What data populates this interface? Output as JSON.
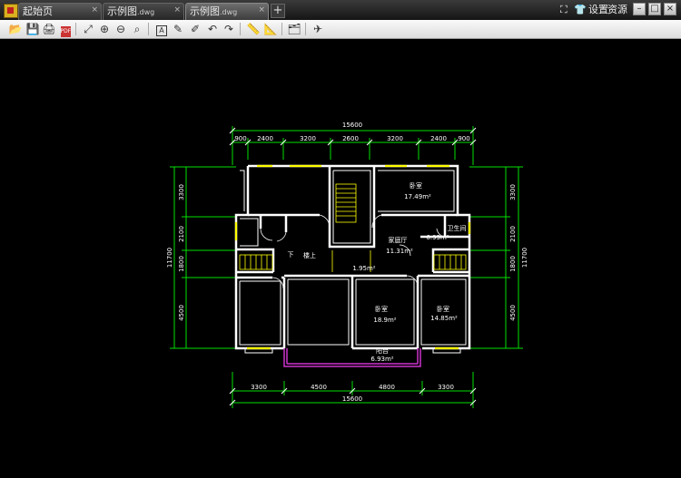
{
  "tabs": [
    {
      "title": "起始页",
      "ext": ""
    },
    {
      "title": "示例图",
      "ext": ".dwg"
    },
    {
      "title": "示例图",
      "ext": ".dwg"
    }
  ],
  "new_tab_label": "+",
  "header_right": {
    "settings_label": "设置",
    "resources_label": "资源"
  },
  "window_controls": {
    "minimize": "–",
    "maximize": "□",
    "close": "×"
  },
  "toolbar_icons": [
    "open-icon",
    "save-icon",
    "print-icon",
    "pdf-export-icon",
    "zoom-window-icon",
    "zoom-in-icon",
    "zoom-out-icon",
    "zoom-extent-icon",
    "text-icon",
    "pen-icon",
    "highlighter-icon",
    "undo-icon",
    "redo-icon",
    "measure-icon",
    "measure-area-icon",
    "layers-icon",
    "share-icon"
  ],
  "drawing": {
    "total_width": "15600",
    "top_dims": [
      "900",
      "2400",
      "3200",
      "2600",
      "3200",
      "2400",
      "900"
    ],
    "bottom_dims": [
      "3300",
      "4500",
      "4800",
      "3300"
    ],
    "left_dims": [
      "3300",
      "2100",
      "1800",
      "4500"
    ],
    "right_dims": [
      "3300",
      "2100",
      "1800",
      "4500"
    ],
    "total_height": "11700",
    "rooms": {
      "bedroom_ne": {
        "name": "卧室",
        "area": "17.49m²"
      },
      "family_hall": {
        "name": "家庭厅",
        "area": "11.31m²"
      },
      "bathroom": {
        "name": "卫生间",
        "area": "6.93m²"
      },
      "bedroom_s": {
        "name": "卧室",
        "area": "18.9m²"
      },
      "bedroom_se": {
        "name": "卧室",
        "area": "14.85m²"
      },
      "balcony": {
        "name": "阳台",
        "area": "6.93m²"
      },
      "stairs_up": "楼上",
      "stairs_down": "下",
      "landing_area": "1.95m²"
    }
  },
  "colors": {
    "background": "#000000",
    "walls": "#ffffff",
    "dimension_lines": "#00ff00",
    "windows": "#ffff00",
    "balcony": "#cc33cc"
  }
}
